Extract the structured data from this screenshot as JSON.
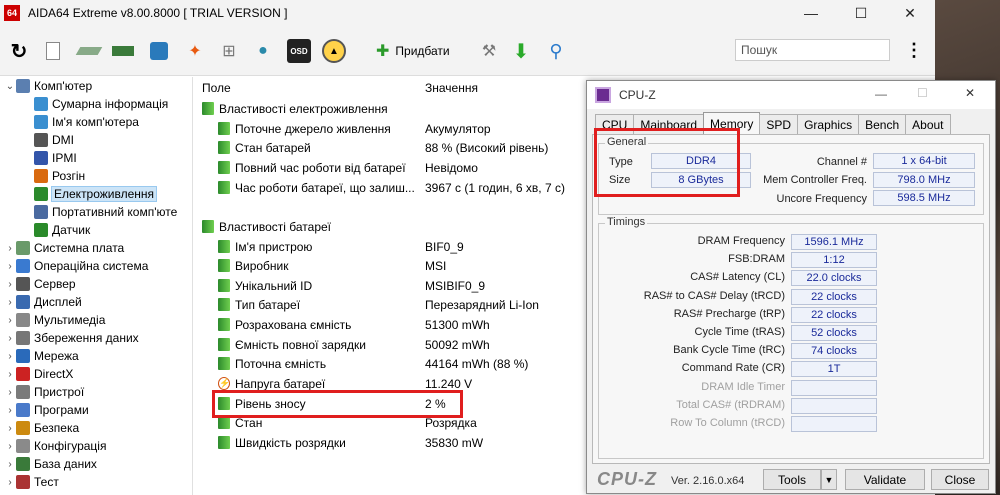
{
  "aida": {
    "logo": "64",
    "title": "AIDA64 Extreme v8.00.8000  [ TRIAL VERSION ]",
    "add_label": "Придбати",
    "search_placeholder": "Пошук",
    "tree": [
      {
        "label": "Комп'ютер",
        "icon": "computer-icon",
        "expander": "⌄"
      },
      {
        "label": "Сумарна інформація",
        "icon": "summary-icon"
      },
      {
        "label": "Ім'я комп'ютера",
        "icon": "computer-name-icon"
      },
      {
        "label": "DMI",
        "icon": "dmi-icon"
      },
      {
        "label": "IPMI",
        "icon": "ipmi-icon"
      },
      {
        "label": "Розгін",
        "icon": "overclock-icon"
      },
      {
        "label": "Електроживлення",
        "icon": "power-icon",
        "selected": true
      },
      {
        "label": "Портативний комп'юте",
        "icon": "portable-icon"
      },
      {
        "label": "Датчик",
        "icon": "sensor-icon"
      },
      {
        "label": "Системна плата",
        "icon": "motherboard-icon",
        "expander": "›"
      },
      {
        "label": "Операційна система",
        "icon": "windows-icon",
        "expander": "›"
      },
      {
        "label": "Сервер",
        "icon": "server-icon",
        "expander": "›"
      },
      {
        "label": "Дисплей",
        "icon": "display-icon",
        "expander": "›"
      },
      {
        "label": "Мультимедіа",
        "icon": "multimedia-icon",
        "expander": "›"
      },
      {
        "label": "Збереження даних",
        "icon": "storage-icon",
        "expander": "›"
      },
      {
        "label": "Мережа",
        "icon": "network-icon",
        "expander": "›"
      },
      {
        "label": "DirectX",
        "icon": "directx-icon",
        "expander": "›"
      },
      {
        "label": "Пристрої",
        "icon": "devices-icon",
        "expander": "›"
      },
      {
        "label": "Програми",
        "icon": "programs-icon",
        "expander": "›"
      },
      {
        "label": "Безпека",
        "icon": "security-icon",
        "expander": "›"
      },
      {
        "label": "Конфігурація",
        "icon": "config-icon",
        "expander": "›"
      },
      {
        "label": "База даних",
        "icon": "database-icon",
        "expander": "›"
      },
      {
        "label": "Тест",
        "icon": "benchmark-icon",
        "expander": "›"
      }
    ],
    "columns": {
      "field": "Поле",
      "value": "Значення"
    },
    "rows": [
      {
        "field": "Властивості електроживлення",
        "value": "",
        "group": true
      },
      {
        "field": "Поточне джерело живлення",
        "value": "Акумулятор"
      },
      {
        "field": "Стан батарей",
        "value": "88 % (Високий рівень)"
      },
      {
        "field": "Повний час роботи від батареї",
        "value": "Невідомо"
      },
      {
        "field": "Час роботи батареї, що залиш...",
        "value": "3967 с (1 годин, 6 хв, 7 с)"
      },
      {
        "field": "Властивості батареї",
        "value": "",
        "group": true
      },
      {
        "field": "Ім'я пристрою",
        "value": "BIF0_9"
      },
      {
        "field": "Виробник",
        "value": "MSI"
      },
      {
        "field": "Унікальний ID",
        "value": "MSIBIF0_9"
      },
      {
        "field": "Тип батареї",
        "value": "Перезарядний Li-Ion"
      },
      {
        "field": "Розрахована ємність",
        "value": "51300 mWh"
      },
      {
        "field": "Ємність повної зарядки",
        "value": "50092 mWh"
      },
      {
        "field": "Поточна ємність",
        "value": "44164 mWh  (88 %)"
      },
      {
        "field": "Напруга батареї",
        "value": "11.240 V",
        "icon": "bolt"
      },
      {
        "field": "Рівень зносу",
        "value": "2 %"
      },
      {
        "field": "Стан",
        "value": "Розрядка"
      },
      {
        "field": "Швидкість розрядки",
        "value": "35830 mW"
      }
    ]
  },
  "cpuz": {
    "title": "CPU-Z",
    "tabs": [
      "CPU",
      "Mainboard",
      "Memory",
      "SPD",
      "Graphics",
      "Bench",
      "About"
    ],
    "active_tab": "Memory",
    "general_label": "General",
    "type_label": "Type",
    "type_value": "DDR4",
    "size_label": "Size",
    "size_value": "8 GBytes",
    "channel_label": "Channel #",
    "channel_value": "1 x 64-bit",
    "mcf_label": "Mem Controller Freq.",
    "mcf_value": "798.0 MHz",
    "uncore_label": "Uncore Frequency",
    "uncore_value": "598.5 MHz",
    "timings_label": "Timings",
    "timings": [
      {
        "label": "DRAM Frequency",
        "value": "1596.1 MHz"
      },
      {
        "label": "FSB:DRAM",
        "value": "1:12"
      },
      {
        "label": "CAS# Latency (CL)",
        "value": "22.0 clocks"
      },
      {
        "label": "RAS# to CAS# Delay (tRCD)",
        "value": "22 clocks"
      },
      {
        "label": "RAS# Precharge (tRP)",
        "value": "22 clocks"
      },
      {
        "label": "Cycle Time (tRAS)",
        "value": "52 clocks"
      },
      {
        "label": "Bank Cycle Time (tRC)",
        "value": "74 clocks"
      },
      {
        "label": "Command Rate (CR)",
        "value": "1T"
      },
      {
        "label": "DRAM Idle Timer",
        "value": "",
        "disabled": true
      },
      {
        "label": "Total CAS# (tRDRAM)",
        "value": "",
        "disabled": true
      },
      {
        "label": "Row To Column (tRCD)",
        "value": "",
        "disabled": true
      }
    ],
    "brand": "CPU-Z",
    "version": "Ver. 2.16.0.x64",
    "tools_label": "Tools",
    "validate_label": "Validate",
    "close_label": "Close"
  },
  "colors": {
    "highlight": "#e01e1e",
    "cpuz_value": "#1a2a9a",
    "selection": "#cce4f7"
  }
}
